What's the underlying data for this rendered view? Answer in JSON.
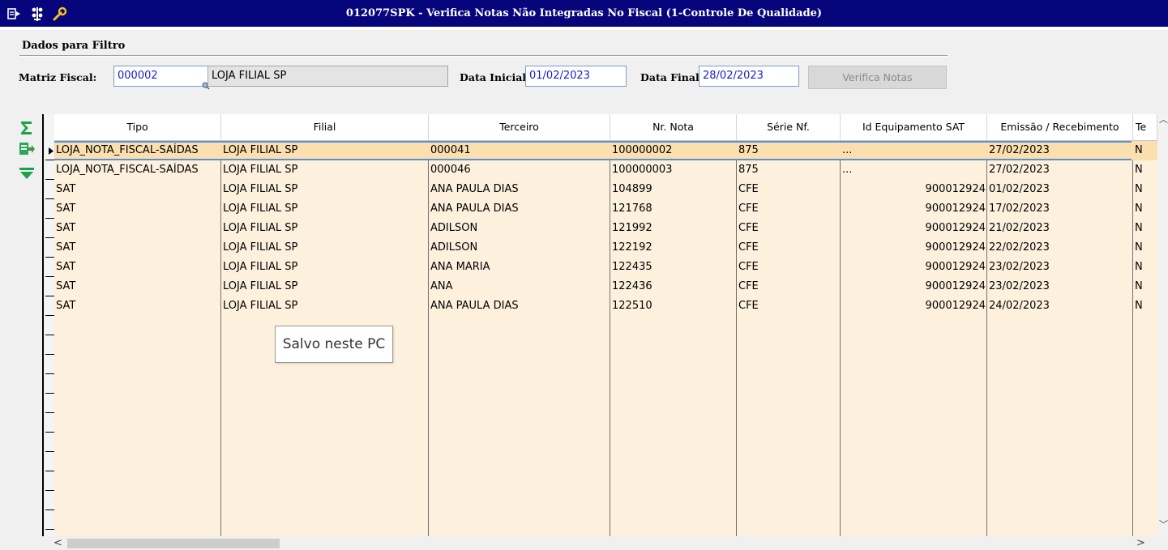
{
  "window": {
    "title": "012077SPK - Verifica Notas Não Integradas No Fiscal (1-Controle De Qualidade)",
    "title_color": "#06057c"
  },
  "filter": {
    "group_title": "Dados para Filtro",
    "matriz_label": "Matriz Fiscal:",
    "matriz_code": "000002",
    "matriz_name": "LOJA FILIAL SP",
    "data_inicial_label": "Data Inicial:",
    "data_inicial": "01/02/2023",
    "data_final_label": "Data Final:",
    "data_final": "28/02/2023",
    "verify_button": "Verifica Notas"
  },
  "grid": {
    "columns": [
      "Tipo",
      "Filial",
      "Terceiro",
      "Nr. Nota",
      "Série Nf.",
      "Id Equipamento SAT",
      "Emissão / Recebimento",
      "Te"
    ],
    "rows": [
      {
        "tipo": "LOJA_NOTA_FISCAL-SAÍDAS",
        "filial": "LOJA FILIAL SP",
        "terceiro": "000041",
        "nota": "100000002",
        "serie": "875",
        "sat": "...",
        "emissao": "27/02/2023",
        "te": "N"
      },
      {
        "tipo": "LOJA_NOTA_FISCAL-SAÍDAS",
        "filial": "LOJA FILIAL SP",
        "terceiro": "000046",
        "nota": "100000003",
        "serie": "875",
        "sat": "...",
        "emissao": "27/02/2023",
        "te": "N"
      },
      {
        "tipo": "SAT",
        "filial": "LOJA FILIAL SP",
        "terceiro": "ANA PAULA DIAS",
        "nota": "104899",
        "serie": "CFE",
        "sat": "900012924",
        "emissao": "01/02/2023",
        "te": "N"
      },
      {
        "tipo": "SAT",
        "filial": "LOJA FILIAL SP",
        "terceiro": "ANA PAULA DIAS",
        "nota": "121768",
        "serie": "CFE",
        "sat": "900012924",
        "emissao": "17/02/2023",
        "te": "N"
      },
      {
        "tipo": "SAT",
        "filial": "LOJA FILIAL SP",
        "terceiro": "ADILSON",
        "nota": "121992",
        "serie": "CFE",
        "sat": "900012924",
        "emissao": "21/02/2023",
        "te": "N"
      },
      {
        "tipo": "SAT",
        "filial": "LOJA FILIAL SP",
        "terceiro": "ADILSON",
        "nota": "122192",
        "serie": "CFE",
        "sat": "900012924",
        "emissao": "22/02/2023",
        "te": "N"
      },
      {
        "tipo": "SAT",
        "filial": "LOJA FILIAL SP",
        "terceiro": "ANA MARIA",
        "nota": "122435",
        "serie": "CFE",
        "sat": "900012924",
        "emissao": "23/02/2023",
        "te": "N"
      },
      {
        "tipo": "SAT",
        "filial": "LOJA FILIAL SP",
        "terceiro": "ANA",
        "nota": "122436",
        "serie": "CFE",
        "sat": "900012924",
        "emissao": "23/02/2023",
        "te": "N"
      },
      {
        "tipo": "SAT",
        "filial": "LOJA FILIAL SP",
        "terceiro": "ANA PAULA DIAS",
        "nota": "122510",
        "serie": "CFE",
        "sat": "900012924",
        "emissao": "24/02/2023",
        "te": "N"
      }
    ],
    "selected_row": 0
  },
  "tooltip": "Salvo neste PC",
  "icons": [
    "menu-icon",
    "tree-icon",
    "wrench-icon",
    "sum-icon",
    "export-icon",
    "filter-icon",
    "scroll-up-icon",
    "scroll-down-icon",
    "scroll-left-icon",
    "scroll-right-icon"
  ]
}
